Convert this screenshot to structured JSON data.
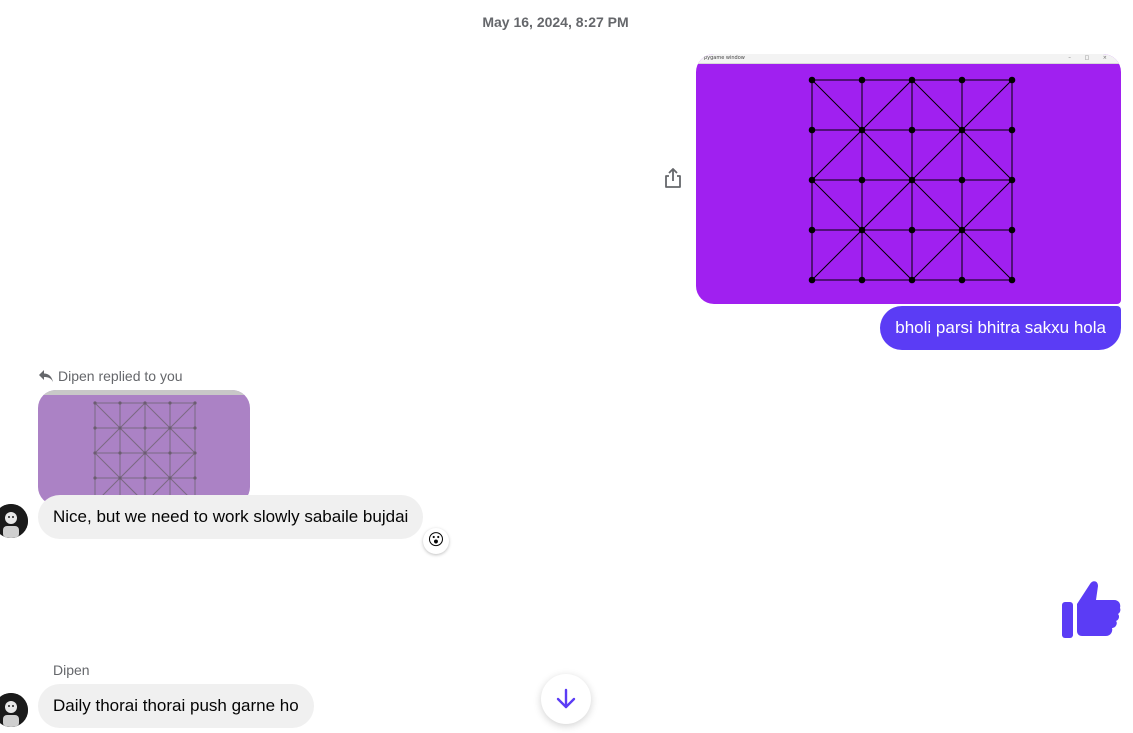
{
  "conversation": {
    "timestamp": "May 16, 2024, 8:27 PM"
  },
  "sent_message": {
    "image_window_title": "pygame window",
    "image_window_controls": "– □ ×",
    "text": "bholi parsi bhitra sakxu hola"
  },
  "reply": {
    "label": "Dipen replied to you",
    "text": "Nice, but we need to work slowly sabaile bujdai",
    "reaction": "😮"
  },
  "last_message": {
    "sender": "Dipen",
    "text": "Daily thorai thorai push garne ho"
  },
  "icons": {
    "share": "share-icon",
    "reply": "reply-arrow-icon",
    "like": "thumbs-up-icon",
    "scroll": "arrow-down-icon"
  },
  "colors": {
    "sent_bubble": "#5b3cf5",
    "image_background": "#a020f0",
    "received_bubble": "#f0f0f0",
    "accent": "#5b3cf5"
  }
}
